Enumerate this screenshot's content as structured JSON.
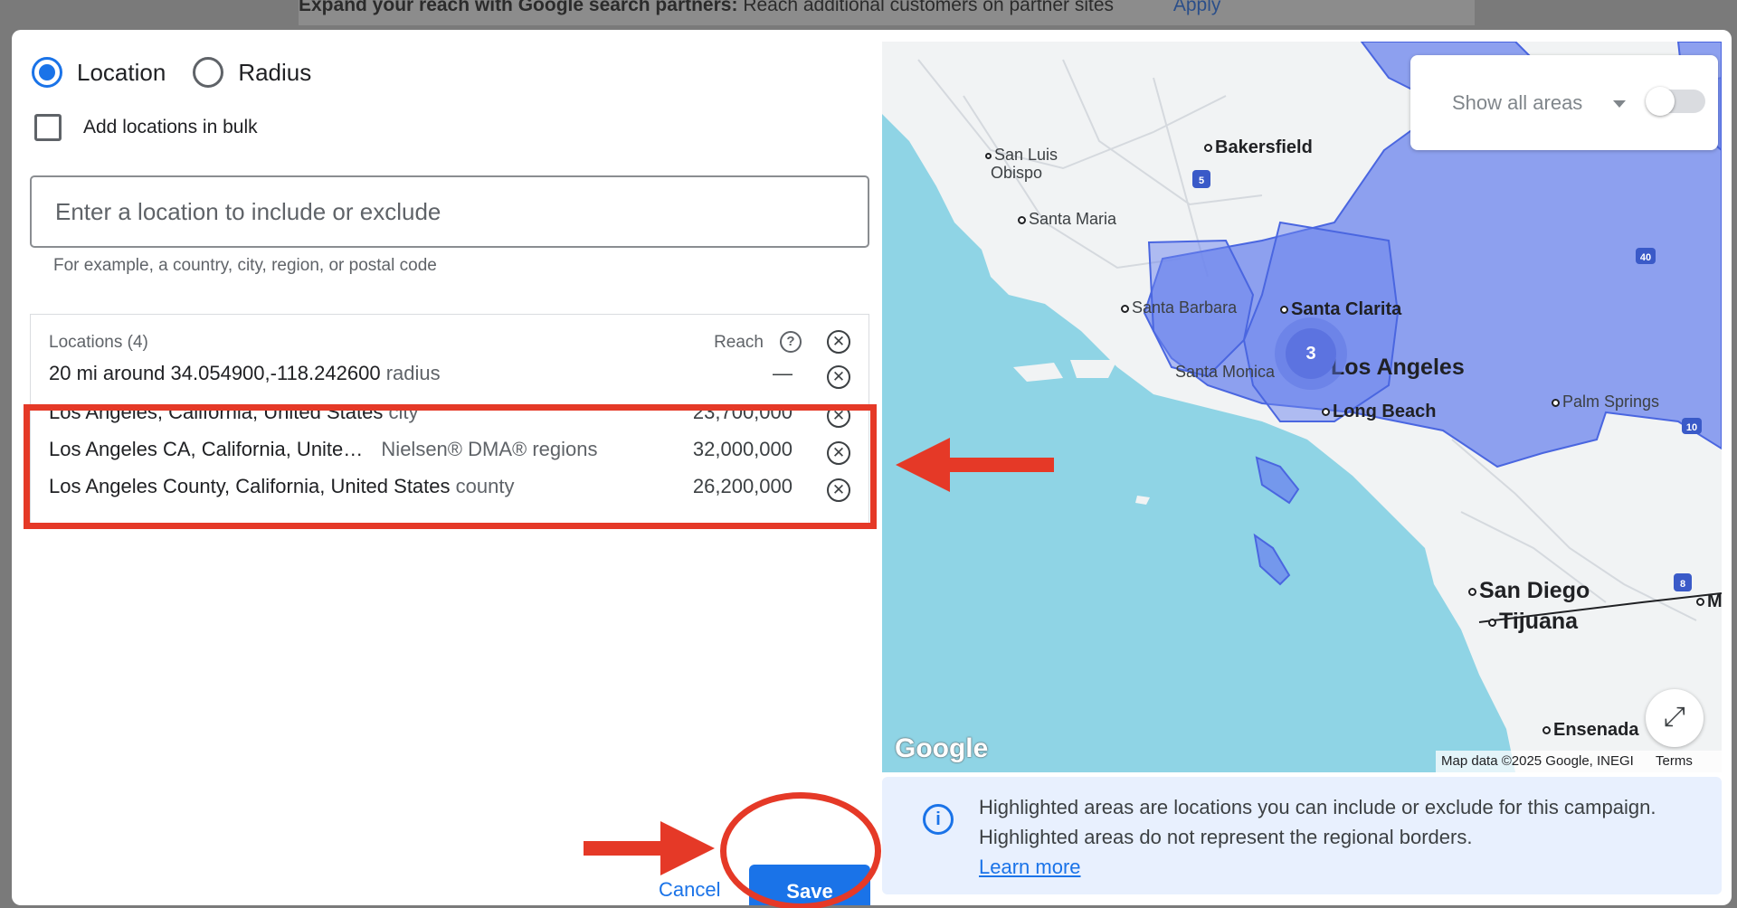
{
  "background": {
    "banner_bold": "Expand your reach with Google search partners:",
    "banner_text": "Reach additional customers on partner sites",
    "banner_apply": "Apply"
  },
  "options": {
    "location_label": "Location",
    "radius_label": "Radius",
    "selected": "Location",
    "bulk_label": "Add locations in bulk"
  },
  "search": {
    "placeholder": "Enter a location to include or exclude",
    "hint": "For example, a country, city, region, or postal code"
  },
  "locations": {
    "header": "Locations (4)",
    "reach_label": "Reach",
    "rows": [
      {
        "name": "20 mi around 34.054900,-118.242600",
        "type": "radius",
        "reach": "—"
      },
      {
        "name": "Los Angeles, California, United States",
        "type": "city",
        "reach": "23,700,000"
      },
      {
        "name": "Los Angeles CA, California, Unite…",
        "type": "Nielsen® DMA® regions",
        "reach": "32,000,000"
      },
      {
        "name": "Los Angeles County, California, United States",
        "type": "county",
        "reach": "26,200,000"
      }
    ]
  },
  "buttons": {
    "cancel": "Cancel",
    "save": "Save"
  },
  "map": {
    "show_all_label": "Show all areas",
    "toggle_on": false,
    "cluster_count": "3",
    "google_logo": "Google",
    "attribution": "Map data ©2025 Google, INEGI",
    "terms": "Terms",
    "labels": {
      "san_luis_obispo_1": "San Luis",
      "san_luis_obispo_2": "Obispo",
      "bakersfield": "Bakersfield",
      "santa_maria": "Santa Maria",
      "santa_barbara": "Santa Barbara",
      "santa_clarita": "Santa Clarita",
      "santa_monica": "Santa Monica",
      "los_angeles": "Los Angeles",
      "long_beach": "Long Beach",
      "palm_springs": "Palm Springs",
      "san_diego": "San Diego",
      "tijuana": "Tijuana",
      "ensenada": "Ensenada",
      "mexicali_partial": "M",
      "hwy5": "5",
      "hwy40": "40",
      "hwy8": "8",
      "hwy10": "10"
    },
    "colors": {
      "water": "#8fd4e5",
      "land": "#f1f3f4",
      "highlight": "#6b84ee"
    }
  },
  "info": {
    "text": "Highlighted areas are locations you can include or exclude for this campaign. Highlighted areas do not represent the regional borders.",
    "link": "Learn more"
  },
  "annotation_colors": {
    "red": "#e53927"
  }
}
